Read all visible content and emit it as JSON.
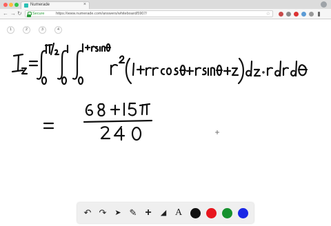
{
  "browser": {
    "tab_title": "Numerade",
    "tab_close": "×",
    "secure_label": "Secure",
    "url": "https://www.numerade.com/answers/whiteboard/5907/",
    "nav": {
      "back": "←",
      "forward": "→",
      "reload": "↻"
    },
    "star": "☆"
  },
  "page_tabs": [
    "1",
    "2",
    "3",
    "4"
  ],
  "whiteboard": {
    "lhs": "Iz",
    "integrand": "r²(1+rrcosθ+rsinθ+z) dz · r dr dθ",
    "limits": {
      "outer_upper": "π/2",
      "outer_lower": "0",
      "middle_upper": "1",
      "middle_lower": "0",
      "inner_upper": "1+rsinθ",
      "inner_lower": "0"
    },
    "result_numerator": "68+15π",
    "result_denominator": "240"
  },
  "tools": {
    "undo": "↶",
    "redo": "↷",
    "pointer": "➤",
    "pen": "✎",
    "add": "+",
    "eraser": "◢",
    "text": "A",
    "colors": [
      "#111111",
      "#e8161e",
      "#16912e",
      "#1a27e6"
    ]
  }
}
